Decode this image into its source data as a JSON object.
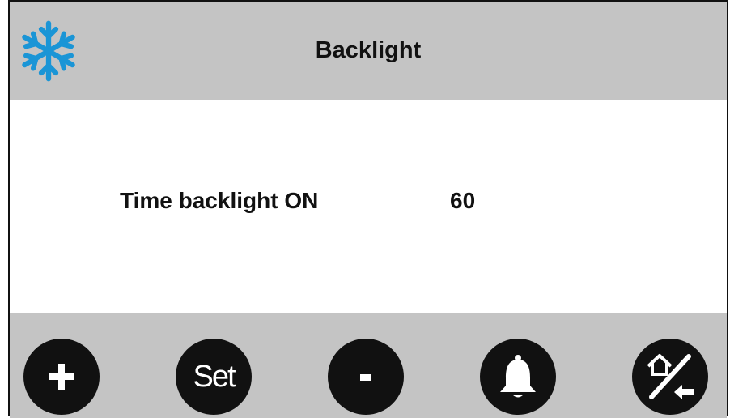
{
  "header": {
    "title": "Backlight",
    "logo_icon": "snowflake-icon",
    "logo_color": "#1a95d6"
  },
  "content": {
    "parameter_label": "Time backlight ON",
    "parameter_value": "60"
  },
  "footer": {
    "buttons": [
      {
        "icon": "plus-icon",
        "label": "+"
      },
      {
        "icon": "set-icon",
        "label": "Set"
      },
      {
        "icon": "minus-icon",
        "label": "-"
      },
      {
        "icon": "bell-icon",
        "label": ""
      },
      {
        "icon": "home-back-icon",
        "label": ""
      }
    ]
  },
  "colors": {
    "bar_gray": "#c4c4c4",
    "button_black": "#111111",
    "text": "#111111"
  }
}
